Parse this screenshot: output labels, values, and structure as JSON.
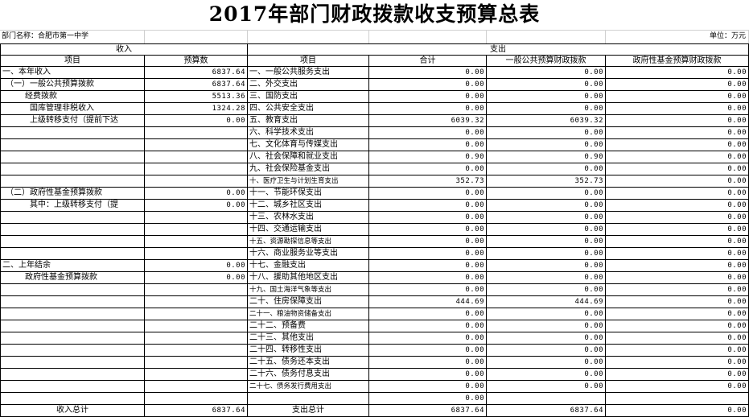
{
  "title": "2017年部门财政拨款收支预算总表",
  "department": "部门名称：合肥市第一中学",
  "unit": "单位：万元",
  "headers": {
    "income": "收入",
    "expense": "支出",
    "income_item": "项目",
    "income_budget": "预算数",
    "expense_item": "项目",
    "total": "合计",
    "general_budget": "一般公共预算财政拨款",
    "fund_budget": "政府性基金预算财政拨款"
  },
  "rows": [
    {
      "in_item": "一、本年收入",
      "in_val": "6837.64",
      "in_cls": "",
      "out_item": "一、一般公共服务支出",
      "total": "0.00",
      "general": "0.00",
      "fund": "0.00"
    },
    {
      "in_item": "（一）一般公共预算拨款",
      "in_val": "6837.64",
      "in_cls": "ind1",
      "out_item": "二、外交支出",
      "total": "0.00",
      "general": "0.00",
      "fund": "0.00"
    },
    {
      "in_item": "经费拨款",
      "in_val": "5513.36",
      "in_cls": "ind2",
      "out_item": "三、国防支出",
      "total": "0.00",
      "general": "0.00",
      "fund": "0.00"
    },
    {
      "in_item": "国库管理非税收入",
      "in_val": "1324.28",
      "in_cls": "ind3",
      "out_item": "四、公共安全支出",
      "total": "0.00",
      "general": "0.00",
      "fund": "0.00"
    },
    {
      "in_item": "上级转移支付（提前下达",
      "in_val": "0.00",
      "in_cls": "ind3",
      "out_item": "五、教育支出",
      "total": "6039.32",
      "general": "6039.32",
      "fund": "0.00"
    },
    {
      "in_item": "",
      "in_val": "",
      "in_cls": "",
      "out_item": "六、科学技术支出",
      "total": "0.00",
      "general": "0.00",
      "fund": "0.00"
    },
    {
      "in_item": "",
      "in_val": "",
      "in_cls": "",
      "out_item": "七、文化体育与传媒支出",
      "total": "0.00",
      "general": "0.00",
      "fund": "0.00"
    },
    {
      "in_item": "",
      "in_val": "",
      "in_cls": "",
      "out_item": "八、社会保障和就业支出",
      "total": "0.90",
      "general": "0.90",
      "fund": "0.00"
    },
    {
      "in_item": "",
      "in_val": "",
      "in_cls": "",
      "out_item": "九、社会保险基金支出",
      "total": "0.00",
      "general": "0.00",
      "fund": "0.00"
    },
    {
      "in_item": "",
      "in_val": "",
      "in_cls": "",
      "out_item": "十、医疗卫生与计划生育支出",
      "total": "352.73",
      "general": "352.73",
      "fund": "0.00"
    },
    {
      "in_item": "（二）政府性基金预算拨款",
      "in_val": "0.00",
      "in_cls": "ind1",
      "out_item": "十一、节能环保支出",
      "total": "0.00",
      "general": "0.00",
      "fund": "0.00"
    },
    {
      "in_item": "其中：上级转移支付（提",
      "in_val": "0.00",
      "in_cls": "ind3",
      "out_item": "十二、城乡社区支出",
      "total": "0.00",
      "general": "0.00",
      "fund": "0.00"
    },
    {
      "in_item": "",
      "in_val": "",
      "in_cls": "",
      "out_item": "十三、农林水支出",
      "total": "0.00",
      "general": "0.00",
      "fund": "0.00"
    },
    {
      "in_item": "",
      "in_val": "",
      "in_cls": "",
      "out_item": "十四、交通运输支出",
      "total": "0.00",
      "general": "0.00",
      "fund": "0.00"
    },
    {
      "in_item": "",
      "in_val": "",
      "in_cls": "",
      "out_item": "十五、资源勘探信息等支出",
      "total": "0.00",
      "general": "0.00",
      "fund": "0.00"
    },
    {
      "in_item": "",
      "in_val": "",
      "in_cls": "",
      "out_item": "十六、商业服务业等支出",
      "total": "0.00",
      "general": "0.00",
      "fund": "0.00"
    },
    {
      "in_item": "二、上年结余",
      "in_val": "0.00",
      "in_cls": "",
      "out_item": "十七、金融支出",
      "total": "0.00",
      "general": "0.00",
      "fund": "0.00"
    },
    {
      "in_item": "政府性基金预算拨款",
      "in_val": "0.00",
      "in_cls": "ind2",
      "out_item": "十八、援助其他地区支出",
      "total": "0.00",
      "general": "0.00",
      "fund": "0.00"
    },
    {
      "in_item": "",
      "in_val": "",
      "in_cls": "",
      "out_item": "十九、国土海洋气象等支出",
      "total": "0.00",
      "general": "0.00",
      "fund": "0.00"
    },
    {
      "in_item": "",
      "in_val": "",
      "in_cls": "",
      "out_item": "二十、住房保障支出",
      "total": "444.69",
      "general": "444.69",
      "fund": "0.00"
    },
    {
      "in_item": "",
      "in_val": "",
      "in_cls": "",
      "out_item": "二十一、粮油物资储备支出",
      "total": "0.00",
      "general": "0.00",
      "fund": "0.00"
    },
    {
      "in_item": "",
      "in_val": "",
      "in_cls": "",
      "out_item": "二十二、预备费",
      "total": "0.00",
      "general": "0.00",
      "fund": "0.00"
    },
    {
      "in_item": "",
      "in_val": "",
      "in_cls": "",
      "out_item": "二十三、其他支出",
      "total": "0.00",
      "general": "0.00",
      "fund": "0.00"
    },
    {
      "in_item": "",
      "in_val": "",
      "in_cls": "",
      "out_item": "二十四、转移性支出",
      "total": "0.00",
      "general": "0.00",
      "fund": "0.00"
    },
    {
      "in_item": "",
      "in_val": "",
      "in_cls": "",
      "out_item": "二十五、债务还本支出",
      "total": "0.00",
      "general": "0.00",
      "fund": "0.00"
    },
    {
      "in_item": "",
      "in_val": "",
      "in_cls": "",
      "out_item": "二十六、债务付息支出",
      "total": "0.00",
      "general": "0.00",
      "fund": "0.00"
    },
    {
      "in_item": "",
      "in_val": "",
      "in_cls": "",
      "out_item": "二十七、债务发行费用支出",
      "total": "0.00",
      "general": "0.00",
      "fund": "0.00"
    },
    {
      "in_item": "",
      "in_val": "",
      "in_cls": "",
      "out_item": "",
      "total": "0.00",
      "general": "",
      "fund": ""
    }
  ],
  "totals": {
    "income_label": "收入总计",
    "income_value": "6837.64",
    "expense_label": "支出总计",
    "total": "6837.64",
    "general": "6837.64",
    "fund": "0.00"
  }
}
